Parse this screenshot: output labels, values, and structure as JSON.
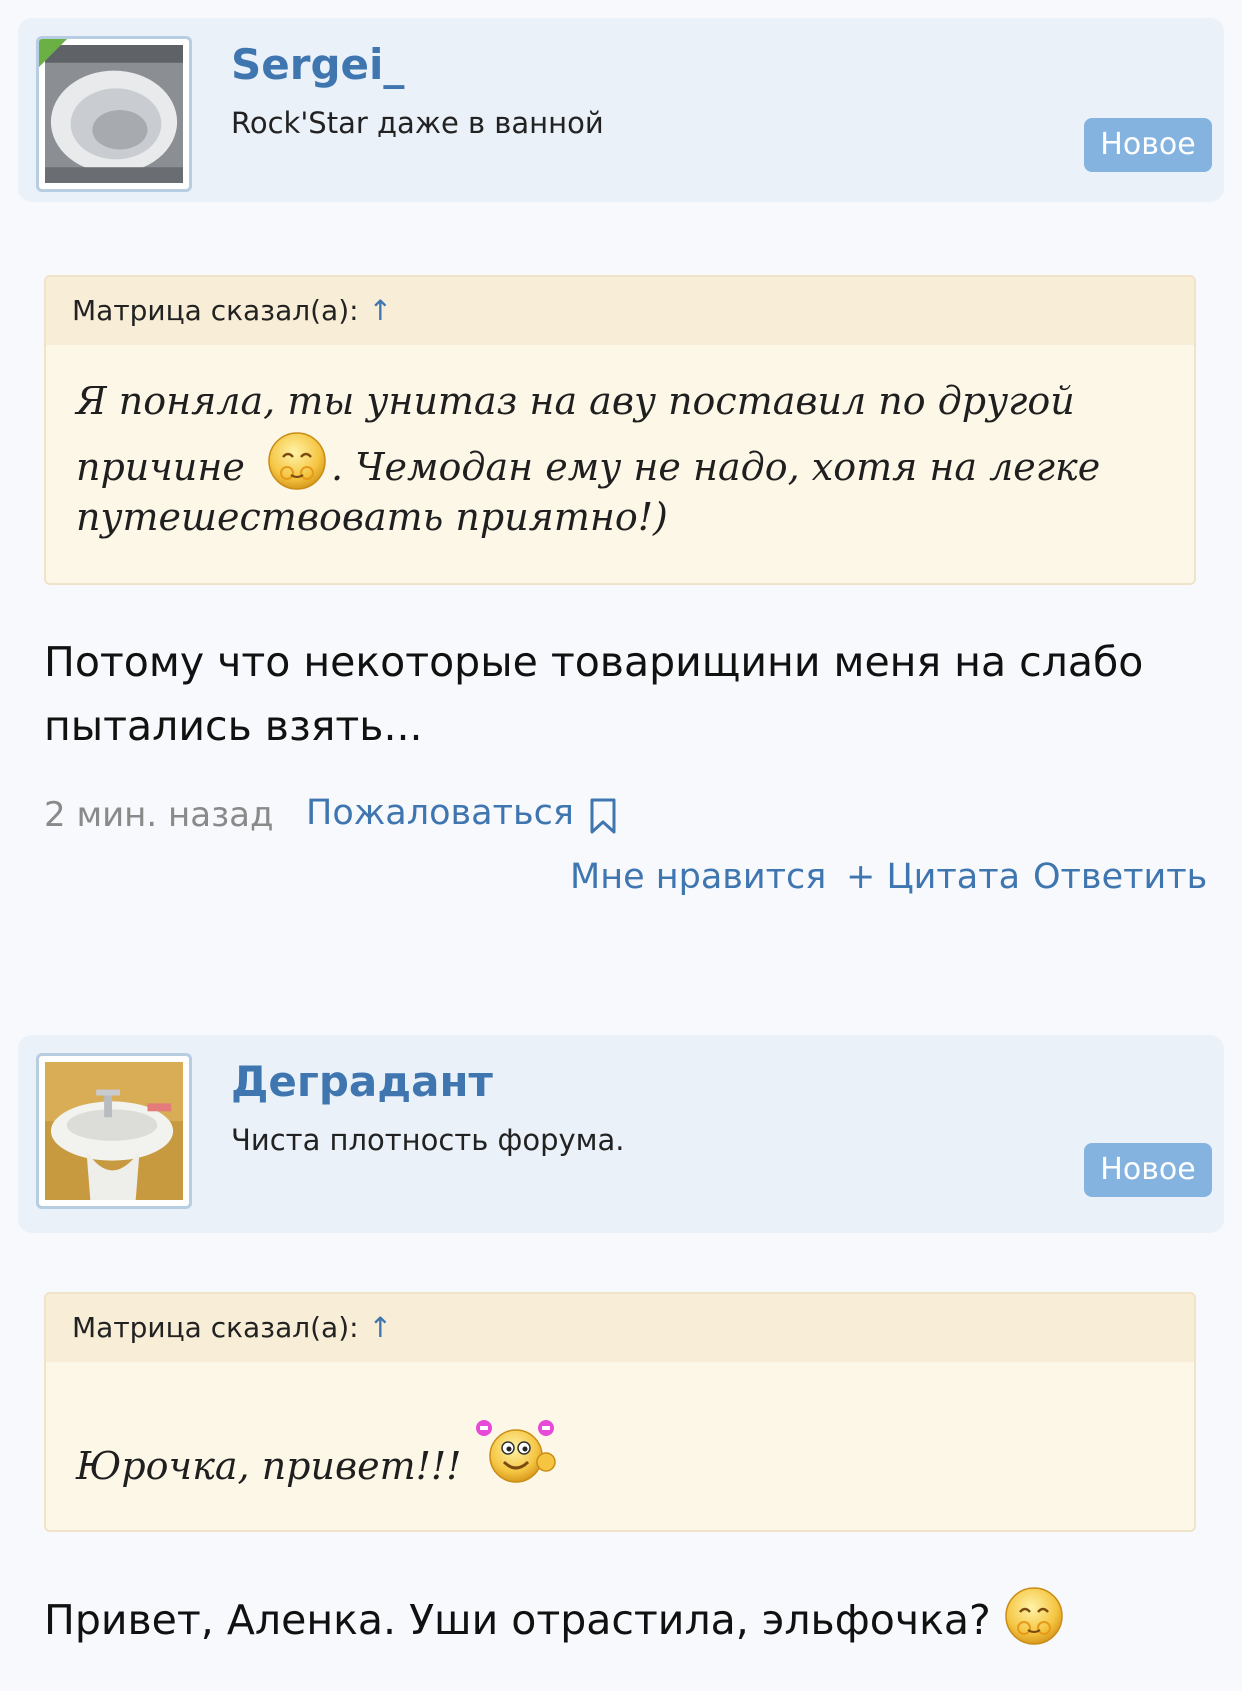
{
  "posts": [
    {
      "username": "Sergei_",
      "user_title": "Rock'Star даже в ванной",
      "badge": "Новое",
      "quote": {
        "author": "Матрица сказал(а):",
        "arrow": "↑",
        "line1": "Я поняла, ты унитаз на аву поставил по другой",
        "line2a": "причине",
        "line2b": ". Чемодан ему не надо, хотя на легке",
        "line3": "путешествовать приятно!)"
      },
      "message_line1": "Потому что некоторые товарищини меня на слабо",
      "message_line2": "пытались взять...",
      "time": "2 мин. назад",
      "report": "Пожаловаться",
      "like": "Мне нравится",
      "quote_action": "+ Цитата",
      "reply": "Ответить"
    },
    {
      "username": "Деградант",
      "user_title": "Чиста плотность форума.",
      "badge": "Новое",
      "quote": {
        "author": "Матрица сказал(а):",
        "arrow": "↑",
        "line1": "Юрочка, привет!!!"
      },
      "message_line1": "Привет, Аленка. Уши отрастила, эльфочка?"
    }
  ],
  "colors": {
    "accent": "#3f76b0",
    "badge": "#84b3e0",
    "header_bg": "#eaf1f9",
    "quote_bg": "#fdf7e8",
    "online": "#6bb045"
  },
  "icons": [
    "bookmark-icon",
    "smiley-blush-icon",
    "smiley-waving-icon"
  ]
}
